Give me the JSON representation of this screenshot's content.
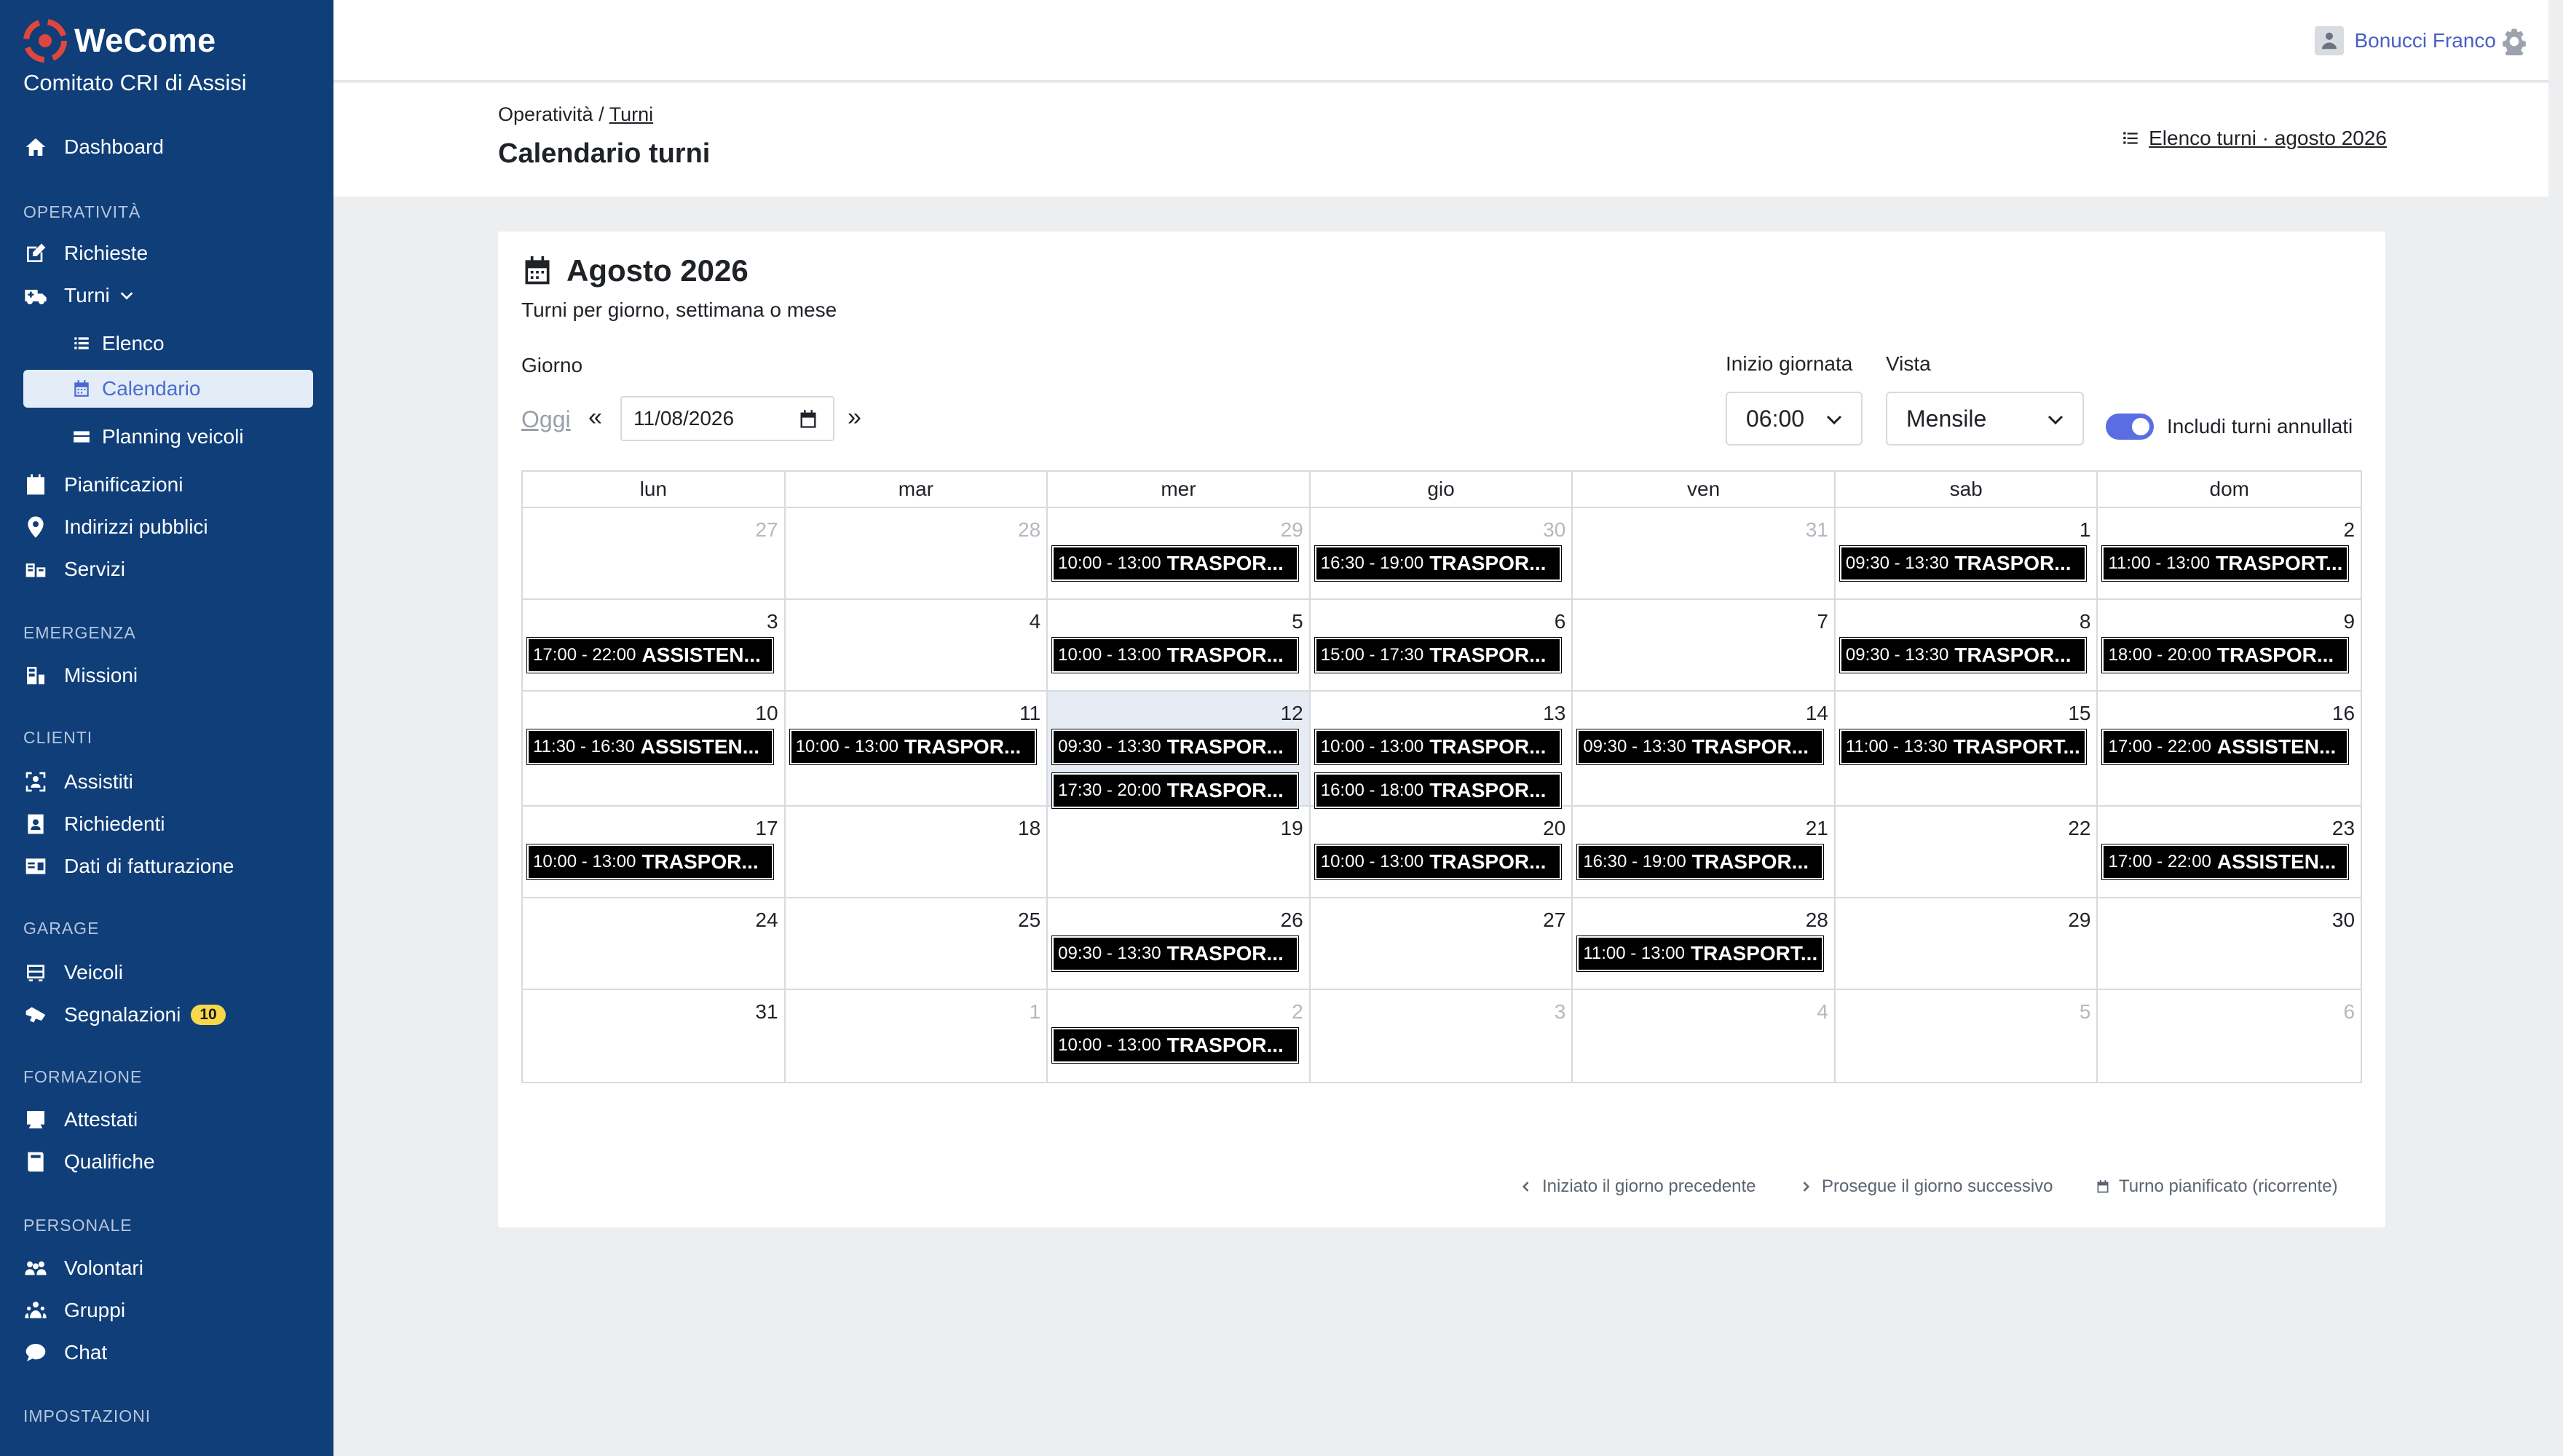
{
  "app": {
    "brand": "WeCome",
    "organization": "Comitato CRI di Assisi"
  },
  "sidebar": {
    "dashboard": "Dashboard",
    "sections": {
      "operativita": "OPERATIVITÀ",
      "emergenza": "EMERGENZA",
      "clienti": "CLIENTI",
      "garage": "GARAGE",
      "formazione": "FORMAZIONE",
      "personale": "PERSONALE",
      "impostazioni": "IMPOSTAZIONI"
    },
    "items": {
      "richieste": "Richieste",
      "turni": "Turni",
      "elenco": "Elenco",
      "calendario": "Calendario",
      "planning_veicoli": "Planning veicoli",
      "pianificazioni": "Pianificazioni",
      "indirizzi_pubblici": "Indirizzi pubblici",
      "servizi": "Servizi",
      "missioni": "Missioni",
      "assistiti": "Assistiti",
      "richiedenti": "Richiedenti",
      "dati_fatturazione": "Dati di fatturazione",
      "veicoli": "Veicoli",
      "segnalazioni": "Segnalazioni",
      "segnalazioni_badge": "10",
      "attestati": "Attestati",
      "qualifiche": "Qualifiche",
      "volontari": "Volontari",
      "gruppi": "Gruppi",
      "chat": "Chat"
    }
  },
  "topbar": {
    "user_name": "Bonucci Franco"
  },
  "header": {
    "breadcrumb_root": "Operatività",
    "breadcrumb_sep": "/",
    "breadcrumb_link": "Turni",
    "title": "Calendario turni",
    "list_link": "Elenco turni · agosto 2026"
  },
  "calendar": {
    "month_title": "Agosto 2026",
    "subtitle": "Turni per giorno, settimana o mese",
    "day_label": "Giorno",
    "today_label": "Oggi",
    "prev": "«",
    "next": "»",
    "date_value": "11/08/2026",
    "start_label": "Inizio giornata",
    "start_value": "06:00",
    "view_label": "Vista",
    "view_value": "Mensile",
    "toggle_label": "Includi turni annullati",
    "toggle_on": true,
    "weekdays": [
      "lun",
      "mar",
      "mer",
      "gio",
      "ven",
      "sab",
      "dom"
    ],
    "weeks": [
      [
        {
          "d": "27",
          "muted": true,
          "shifts": []
        },
        {
          "d": "28",
          "muted": true,
          "shifts": []
        },
        {
          "d": "29",
          "muted": true,
          "shifts": [
            {
              "time": "10:00 - 13:00",
              "label": "TRASPOR..."
            }
          ]
        },
        {
          "d": "30",
          "muted": true,
          "shifts": [
            {
              "time": "16:30 - 19:00",
              "label": "TRASPOR..."
            }
          ]
        },
        {
          "d": "31",
          "muted": true,
          "shifts": []
        },
        {
          "d": "1",
          "muted": false,
          "shifts": [
            {
              "time": "09:30 - 13:30",
              "label": "TRASPOR..."
            }
          ]
        },
        {
          "d": "2",
          "muted": false,
          "shifts": [
            {
              "time": "11:00 - 13:00",
              "label": "TRASPORT..."
            }
          ]
        }
      ],
      [
        {
          "d": "3",
          "muted": false,
          "shifts": [
            {
              "time": "17:00 - 22:00",
              "label": "ASSISTEN..."
            }
          ]
        },
        {
          "d": "4",
          "muted": false,
          "shifts": []
        },
        {
          "d": "5",
          "muted": false,
          "shifts": [
            {
              "time": "10:00 - 13:00",
              "label": "TRASPOR..."
            }
          ]
        },
        {
          "d": "6",
          "muted": false,
          "shifts": [
            {
              "time": "15:00 - 17:30",
              "label": "TRASPOR..."
            }
          ]
        },
        {
          "d": "7",
          "muted": false,
          "shifts": []
        },
        {
          "d": "8",
          "muted": false,
          "shifts": [
            {
              "time": "09:30 - 13:30",
              "label": "TRASPOR..."
            }
          ]
        },
        {
          "d": "9",
          "muted": false,
          "shifts": [
            {
              "time": "18:00 - 20:00",
              "label": "TRASPOR..."
            }
          ]
        }
      ],
      [
        {
          "d": "10",
          "muted": false,
          "shifts": [
            {
              "time": "11:30 - 16:30",
              "label": "ASSISTEN..."
            }
          ]
        },
        {
          "d": "11",
          "muted": false,
          "shifts": [
            {
              "time": "10:00 - 13:00",
              "label": "TRASPOR..."
            }
          ]
        },
        {
          "d": "12",
          "muted": false,
          "today": true,
          "shifts": [
            {
              "time": "09:30 - 13:30",
              "label": "TRASPOR..."
            },
            {
              "time": "17:30 - 20:00",
              "label": "TRASPOR..."
            }
          ]
        },
        {
          "d": "13",
          "muted": false,
          "shifts": [
            {
              "time": "10:00 - 13:00",
              "label": "TRASPOR..."
            },
            {
              "time": "16:00 - 18:00",
              "label": "TRASPOR..."
            }
          ]
        },
        {
          "d": "14",
          "muted": false,
          "shifts": [
            {
              "time": "09:30 - 13:30",
              "label": "TRASPOR..."
            }
          ]
        },
        {
          "d": "15",
          "muted": false,
          "shifts": [
            {
              "time": "11:00 - 13:30",
              "label": "TRASPORT..."
            }
          ]
        },
        {
          "d": "16",
          "muted": false,
          "shifts": [
            {
              "time": "17:00 - 22:00",
              "label": "ASSISTEN..."
            }
          ]
        }
      ],
      [
        {
          "d": "17",
          "muted": false,
          "shifts": [
            {
              "time": "10:00 - 13:00",
              "label": "TRASPOR..."
            }
          ]
        },
        {
          "d": "18",
          "muted": false,
          "shifts": []
        },
        {
          "d": "19",
          "muted": false,
          "shifts": []
        },
        {
          "d": "20",
          "muted": false,
          "shifts": [
            {
              "time": "10:00 - 13:00",
              "label": "TRASPOR..."
            }
          ]
        },
        {
          "d": "21",
          "muted": false,
          "shifts": [
            {
              "time": "16:30 - 19:00",
              "label": "TRASPOR..."
            }
          ]
        },
        {
          "d": "22",
          "muted": false,
          "shifts": []
        },
        {
          "d": "23",
          "muted": false,
          "shifts": [
            {
              "time": "17:00 - 22:00",
              "label": "ASSISTEN..."
            }
          ]
        }
      ],
      [
        {
          "d": "24",
          "muted": false,
          "shifts": []
        },
        {
          "d": "25",
          "muted": false,
          "shifts": []
        },
        {
          "d": "26",
          "muted": false,
          "shifts": [
            {
              "time": "09:30 - 13:30",
              "label": "TRASPOR..."
            }
          ]
        },
        {
          "d": "27",
          "muted": false,
          "shifts": []
        },
        {
          "d": "28",
          "muted": false,
          "shifts": [
            {
              "time": "11:00 - 13:00",
              "label": "TRASPORT..."
            }
          ]
        },
        {
          "d": "29",
          "muted": false,
          "shifts": []
        },
        {
          "d": "30",
          "muted": false,
          "shifts": []
        }
      ],
      [
        {
          "d": "31",
          "muted": false,
          "shifts": []
        },
        {
          "d": "1",
          "muted": true,
          "shifts": []
        },
        {
          "d": "2",
          "muted": true,
          "shifts": [
            {
              "time": "10:00 - 13:00",
              "label": "TRASPOR..."
            }
          ]
        },
        {
          "d": "3",
          "muted": true,
          "shifts": []
        },
        {
          "d": "4",
          "muted": true,
          "shifts": []
        },
        {
          "d": "5",
          "muted": true,
          "shifts": []
        },
        {
          "d": "6",
          "muted": true,
          "shifts": []
        }
      ]
    ],
    "legend": {
      "prev_day": "Iniziato il giorno precedente",
      "next_day": "Prosegue il giorno successivo",
      "recurring": "Turno pianificato (ricorrente)"
    }
  },
  "colors": {
    "sidebar_bg": "#0f3e79",
    "accent": "#4a6cd1",
    "shift_bg": "#000000",
    "today_bg": "#e7ecf4",
    "toggle_on": "#5b6ee1",
    "badge": "#f7d84a"
  }
}
